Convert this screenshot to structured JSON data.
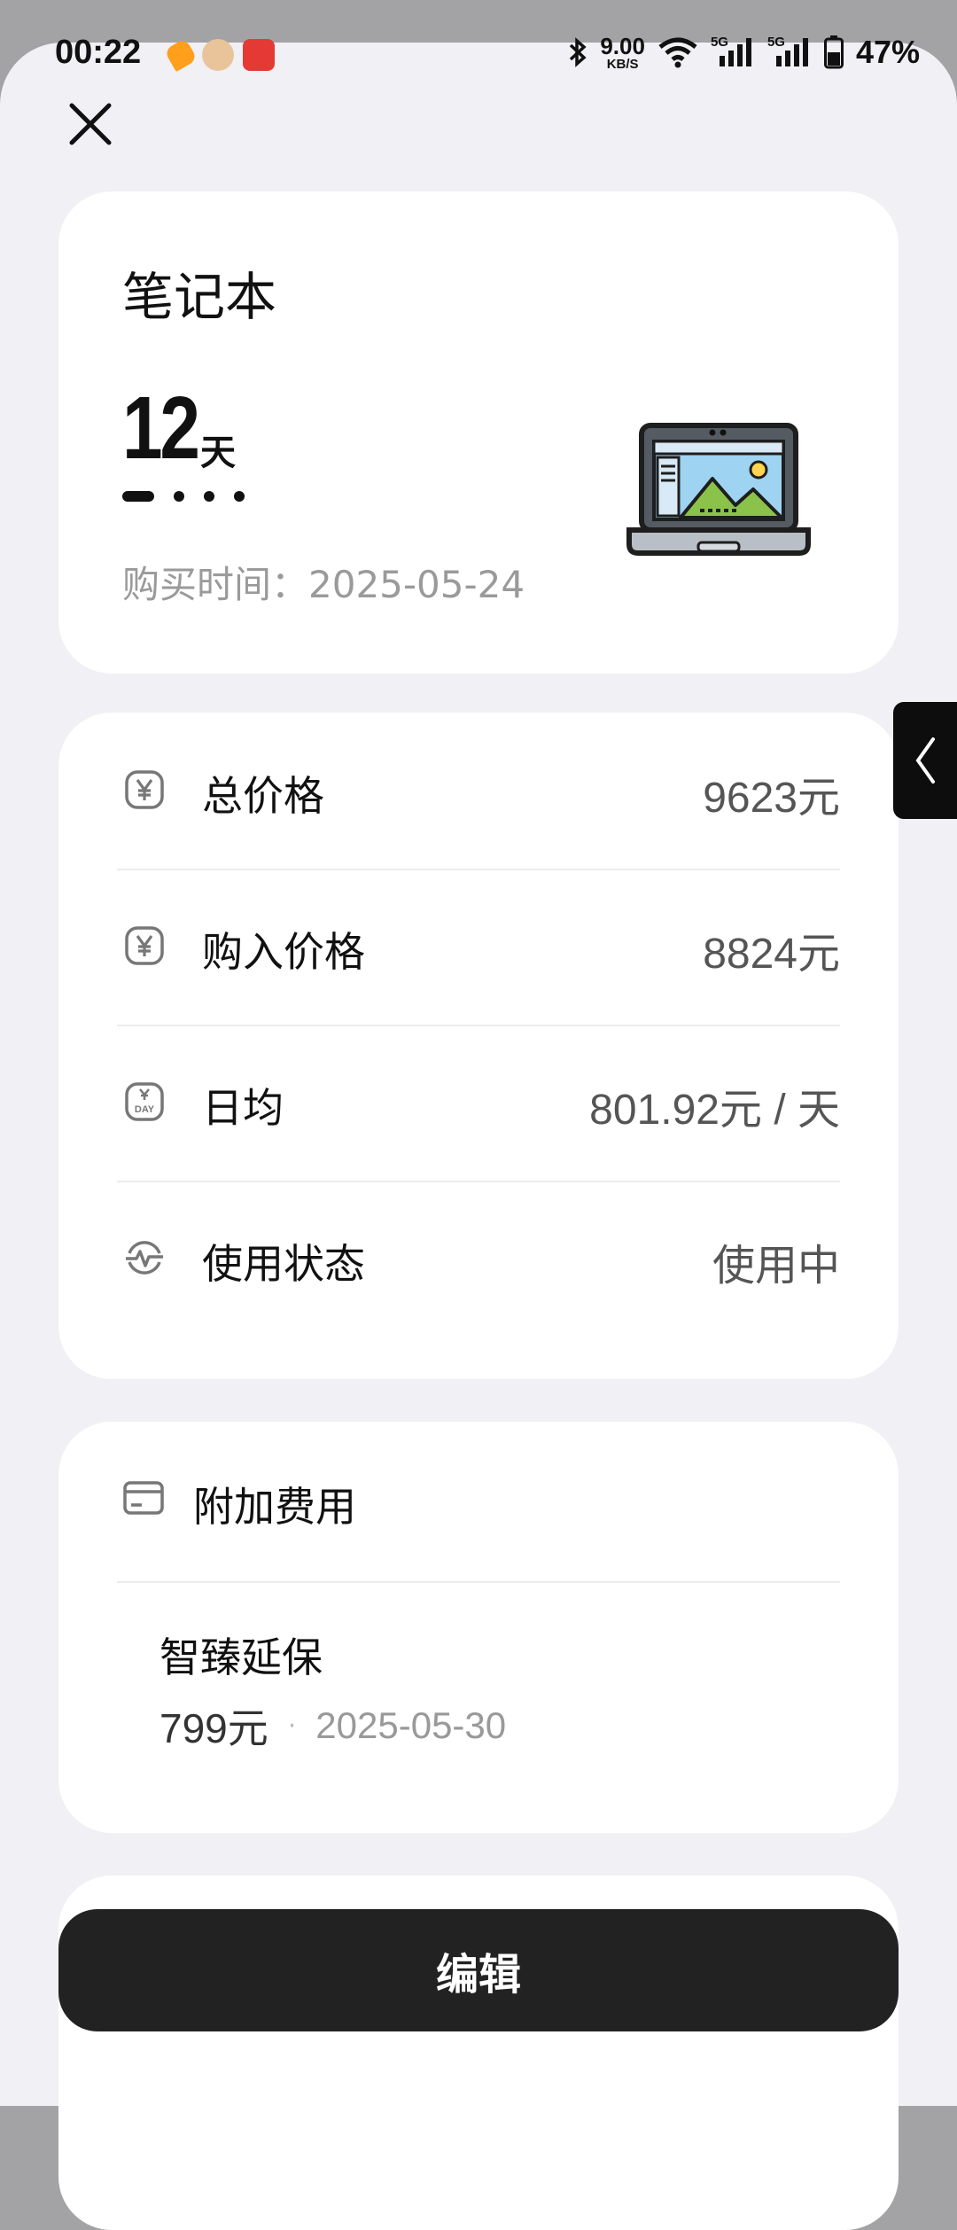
{
  "status_bar": {
    "time": "00:22",
    "net_speed_value": "9.00",
    "net_speed_unit": "KB/S",
    "signal_1": "5G",
    "signal_2": "5G",
    "battery": "47%"
  },
  "header": {
    "close_icon": "close-icon"
  },
  "item": {
    "title": "笔记本",
    "days_used": "12",
    "days_unit": "天",
    "purchase_time_label": "购买时间：",
    "purchase_date": "2025-05-24",
    "image_icon": "laptop-icon",
    "page_indicator": {
      "active": 0,
      "count": 4
    }
  },
  "prices": [
    {
      "icon": "yen-icon",
      "label": "总价格",
      "value": "9623元"
    },
    {
      "icon": "yen-icon",
      "label": "购入价格",
      "value": "8824元"
    },
    {
      "icon": "day-yen-icon",
      "label": "日均",
      "value": "801.92元 / 天"
    },
    {
      "icon": "pulse-icon",
      "label": "使用状态",
      "value": "使用中"
    }
  ],
  "extra_costs": {
    "title": "附加费用",
    "icon": "card-icon",
    "items": [
      {
        "name": "智臻延保",
        "amount": "799元",
        "separator": "·",
        "date": "2025-05-30"
      }
    ]
  },
  "side_tab": {
    "icon": "chevron-left-icon"
  },
  "actions": {
    "edit_label": "编辑"
  }
}
